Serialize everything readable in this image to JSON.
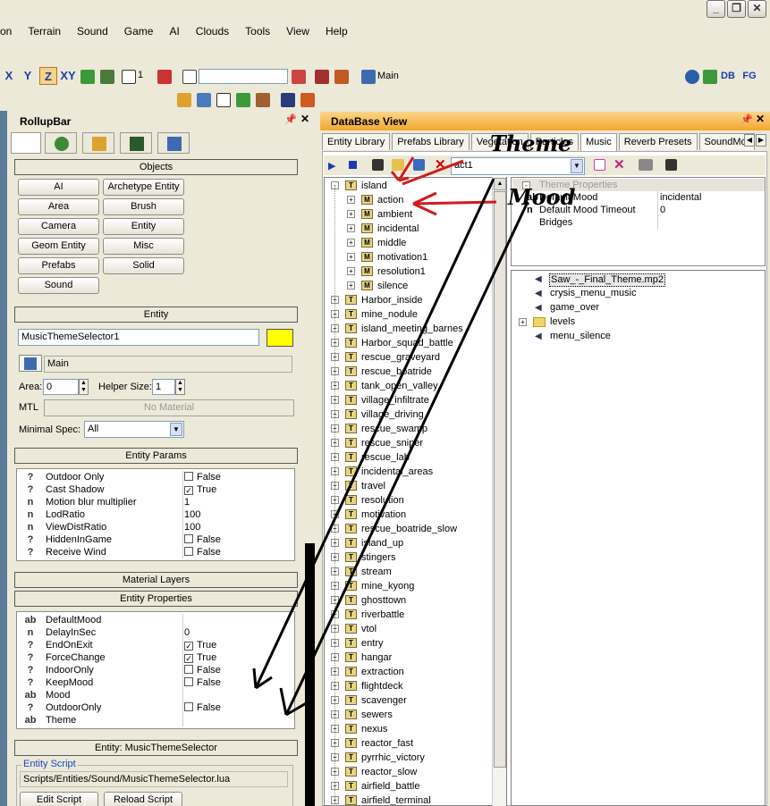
{
  "menu": [
    "on",
    "Terrain",
    "Sound",
    "Game",
    "AI",
    "Clouds",
    "Tools",
    "View",
    "Help"
  ],
  "window_buttons": [
    "_",
    "❐",
    "✕"
  ],
  "toolbar": {
    "axes": [
      "X",
      "Y",
      "Z",
      "XY"
    ],
    "snap": "1",
    "layer": "Main",
    "right": [
      "DB",
      "FG"
    ]
  },
  "rollup": {
    "title": "RollupBar",
    "objects": {
      "header": "Objects",
      "buttons": [
        "AI",
        "Archetype Entity",
        "Area",
        "Brush",
        "Camera",
        "Entity",
        "Geom Entity",
        "Misc",
        "Prefabs",
        "Solid",
        "Sound"
      ]
    },
    "entity": {
      "header": "Entity",
      "name": "MusicThemeSelector1",
      "layer": "Main",
      "area_label": "Area:",
      "area_value": "0",
      "helper_label": "Helper Size:",
      "helper_value": "1",
      "mtl_label": "MTL",
      "mtl_value": "No Material",
      "minspec_label": "Minimal Spec:",
      "minspec_value": "All"
    },
    "entity_params": {
      "header": "Entity Params",
      "rows": [
        {
          "k": "?",
          "n": "Outdoor Only",
          "v": "False",
          "cb": "unchecked"
        },
        {
          "k": "?",
          "n": "Cast Shadow",
          "v": "True",
          "cb": "checked"
        },
        {
          "k": "n",
          "n": "Motion blur multiplier",
          "v": "1",
          "cb": "none"
        },
        {
          "k": "n",
          "n": "LodRatio",
          "v": "100",
          "cb": "none"
        },
        {
          "k": "n",
          "n": "ViewDistRatio",
          "v": "100",
          "cb": "none"
        },
        {
          "k": "?",
          "n": "HiddenInGame",
          "v": "False",
          "cb": "unchecked"
        },
        {
          "k": "?",
          "n": "Receive Wind",
          "v": "False",
          "cb": "unchecked"
        }
      ]
    },
    "material_layers": "Material Layers",
    "entity_properties": {
      "header": "Entity Properties",
      "rows": [
        {
          "k": "ab",
          "n": "DefaultMood",
          "v": "",
          "cb": "none"
        },
        {
          "k": "n",
          "n": "DelayInSec",
          "v": "0",
          "cb": "none"
        },
        {
          "k": "?",
          "n": "EndOnExit",
          "v": "True",
          "cb": "checked"
        },
        {
          "k": "?",
          "n": "ForceChange",
          "v": "True",
          "cb": "checked"
        },
        {
          "k": "?",
          "n": "IndoorOnly",
          "v": "False",
          "cb": "unchecked"
        },
        {
          "k": "?",
          "n": "KeepMood",
          "v": "False",
          "cb": "unchecked"
        },
        {
          "k": "ab",
          "n": "Mood",
          "v": "",
          "cb": "none"
        },
        {
          "k": "?",
          "n": "OutdoorOnly",
          "v": "False",
          "cb": "unchecked"
        },
        {
          "k": "ab",
          "n": "Theme",
          "v": "",
          "cb": "none"
        }
      ]
    },
    "script": {
      "header": "Entity: MusicThemeSelector",
      "group_label": "Entity Script",
      "path": "Scripts/Entities/Sound/MusicThemeSelector.lua",
      "edit": "Edit Script",
      "reload": "Reload Script"
    }
  },
  "db": {
    "title": "DataBase View",
    "tabs": [
      "Entity Library",
      "Prefabs Library",
      "Vegetation",
      "Particles",
      "Music",
      "Reverb Presets",
      "SoundMoods"
    ],
    "active_tab": "Music",
    "act_value": "act1",
    "tree": [
      {
        "label": "island",
        "level": 0,
        "pm": "-"
      },
      {
        "label": "action",
        "level": 1,
        "pm": "+"
      },
      {
        "label": "ambient",
        "level": 1,
        "pm": "+"
      },
      {
        "label": "incidental",
        "level": 1,
        "pm": "+"
      },
      {
        "label": "middle",
        "level": 1,
        "pm": "+"
      },
      {
        "label": "motivation1",
        "level": 1,
        "pm": "+"
      },
      {
        "label": "resolution1",
        "level": 1,
        "pm": "+"
      },
      {
        "label": "silence",
        "level": 1,
        "pm": "+"
      },
      {
        "label": "Harbor_inside",
        "level": 0,
        "pm": "+"
      },
      {
        "label": "mine_nodule",
        "level": 0,
        "pm": "+"
      },
      {
        "label": "island_meeting_barnes",
        "level": 0,
        "pm": "+"
      },
      {
        "label": "Harbor_squad_battle",
        "level": 0,
        "pm": "+"
      },
      {
        "label": "rescue_graveyard",
        "level": 0,
        "pm": "+"
      },
      {
        "label": "rescue_boatride",
        "level": 0,
        "pm": "+"
      },
      {
        "label": "tank_open_valley",
        "level": 0,
        "pm": "+"
      },
      {
        "label": "village_infiltrate",
        "level": 0,
        "pm": "+"
      },
      {
        "label": "village_driving",
        "level": 0,
        "pm": "+"
      },
      {
        "label": "rescue_swamp",
        "level": 0,
        "pm": "+"
      },
      {
        "label": "rescue_sniper",
        "level": 0,
        "pm": "+"
      },
      {
        "label": "rescue_lab",
        "level": 0,
        "pm": "+"
      },
      {
        "label": "incidental_areas",
        "level": 0,
        "pm": "+"
      },
      {
        "label": "travel",
        "level": 0,
        "pm": "+"
      },
      {
        "label": "resolution",
        "level": 0,
        "pm": "+"
      },
      {
        "label": "motivation",
        "level": 0,
        "pm": "+"
      },
      {
        "label": "rescue_boatride_slow",
        "level": 0,
        "pm": "+"
      },
      {
        "label": "island_up",
        "level": 0,
        "pm": "+"
      },
      {
        "label": "stingers",
        "level": 0,
        "pm": "+"
      },
      {
        "label": "stream",
        "level": 0,
        "pm": "+"
      },
      {
        "label": "mine_kyong",
        "level": 0,
        "pm": "+"
      },
      {
        "label": "ghosttown",
        "level": 0,
        "pm": "+"
      },
      {
        "label": "riverbattle",
        "level": 0,
        "pm": "+"
      },
      {
        "label": "vtol",
        "level": 0,
        "pm": "+"
      },
      {
        "label": "entry",
        "level": 0,
        "pm": "+"
      },
      {
        "label": "hangar",
        "level": 0,
        "pm": "+"
      },
      {
        "label": "extraction",
        "level": 0,
        "pm": "+"
      },
      {
        "label": "flightdeck",
        "level": 0,
        "pm": "+"
      },
      {
        "label": "scavenger",
        "level": 0,
        "pm": "+"
      },
      {
        "label": "sewers",
        "level": 0,
        "pm": "+"
      },
      {
        "label": "nexus",
        "level": 0,
        "pm": "+"
      },
      {
        "label": "reactor_fast",
        "level": 0,
        "pm": "+"
      },
      {
        "label": "pyrrhic_victory",
        "level": 0,
        "pm": "+"
      },
      {
        "label": "reactor_slow",
        "level": 0,
        "pm": "+"
      },
      {
        "label": "airfield_battle",
        "level": 0,
        "pm": "+"
      },
      {
        "label": "airfield_terminal",
        "level": 0,
        "pm": "+"
      }
    ],
    "props": {
      "header": "Theme Properties",
      "rows": [
        {
          "k": "ab",
          "n": "Default Mood",
          "v": "incidental"
        },
        {
          "k": "n",
          "n": "Default Mood Timeout",
          "v": "0"
        },
        {
          "k": "",
          "n": "Bridges",
          "v": ""
        }
      ]
    },
    "sounds": [
      {
        "label": "Saw_-_Final_Theme.mp2",
        "type": "sound",
        "selected": true
      },
      {
        "label": "crysis_menu_music",
        "type": "sound"
      },
      {
        "label": "game_over",
        "type": "sound"
      },
      {
        "label": "levels",
        "type": "folder"
      },
      {
        "label": "menu_silence",
        "type": "sound"
      }
    ]
  },
  "annotations": {
    "theme": "Theme",
    "mood": "Mood"
  }
}
